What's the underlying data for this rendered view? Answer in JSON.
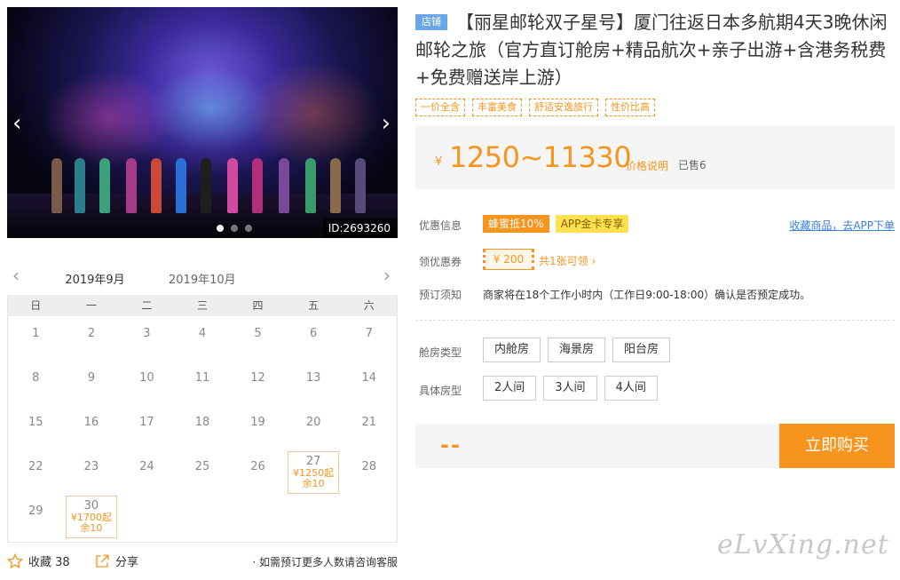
{
  "gallery": {
    "prev_label": "‹",
    "next_label": "›",
    "image_id": "ID:2693260",
    "slide_count": 3,
    "active_slide": 1
  },
  "calendar": {
    "months": [
      "2019年9月",
      "2019年10月"
    ],
    "active_month": 0,
    "weekdays": [
      "日",
      "一",
      "二",
      "三",
      "四",
      "五",
      "六"
    ],
    "first_weekday": 0,
    "days_in_month": 30,
    "available": [
      {
        "day": "27",
        "price": "¥1250起",
        "remaining": "余10"
      },
      {
        "day": "30",
        "price": "¥1700起",
        "remaining": "余10"
      }
    ]
  },
  "social": {
    "fav_label": "收藏 38",
    "share_label": "分享",
    "note": "· 如需预订更多人数请咨询客服"
  },
  "product": {
    "shop_badge": "店铺",
    "title": "【丽星邮轮双子星号】厦门往返日本多航期4天3晚休闲邮轮之旅（官方直订舱房+精品航次+亲子出游+含港务税费+免费赠送岸上游）",
    "tags": [
      "一价全含",
      "丰富美食",
      "舒适安逸旅行",
      "性价比高"
    ],
    "price_currency": "¥",
    "price_range": "1250~11330",
    "price_explain": "价格说明",
    "sold": "已售6"
  },
  "discount": {
    "label": "优惠信息",
    "tags": [
      "蜂蜜抵10%",
      "APP金卡专享"
    ],
    "app_link": "收藏商品，去APP下单"
  },
  "coupon": {
    "label": "领优惠券",
    "value": "¥ 200",
    "count": "共1张可领 ›"
  },
  "booking": {
    "label": "预订须知",
    "notice": "商家将在18个工作小时内（工作日9:00-18:00）确认是否预定成功。"
  },
  "cabin_type": {
    "label": "舱房类型",
    "options": [
      "内舱房",
      "海景房",
      "阳台房"
    ]
  },
  "room_type": {
    "label": "具体房型",
    "options": [
      "2人间",
      "3人间",
      "4人间"
    ]
  },
  "buy": {
    "total": "--",
    "button": "立即购买"
  },
  "watermark": "eLvXing.net",
  "colors": {
    "accent": "#f7941d",
    "shop_badge": "#6aa6e8",
    "link": "#3b7fd6",
    "app_tag": "#ffe14d"
  }
}
